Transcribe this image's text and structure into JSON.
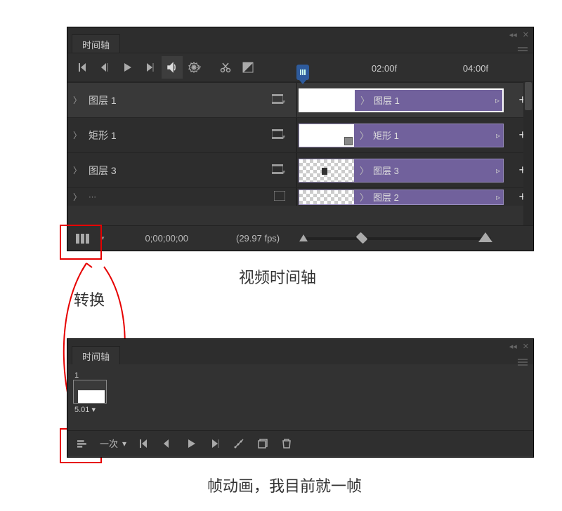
{
  "panel_title": "时间轴",
  "time_marks": [
    "02:00f",
    "04:00f"
  ],
  "layers": [
    {
      "name": "图层 1",
      "clip_label": "图层 1",
      "selected": true,
      "thumb": "white"
    },
    {
      "name": "矩形 1",
      "clip_label": "矩形 1",
      "selected": false,
      "thumb": "white-handle"
    },
    {
      "name": "图层 3",
      "clip_label": "图层 3",
      "selected": false,
      "thumb": "checker-dot"
    },
    {
      "name": "",
      "clip_label": "图层 2",
      "selected": false,
      "thumb": "checker",
      "cut": true
    }
  ],
  "footer": {
    "timecode": "0;00;00;00",
    "fps": "(29.97 fps)"
  },
  "caption_video": "视频时间轴",
  "caption_swap": "转换",
  "caption_frame": "帧动画，我目前就一帧",
  "frame_panel": {
    "frame_number": "1",
    "frame_delay": "5.01 ▾",
    "loop_label": "一次"
  }
}
